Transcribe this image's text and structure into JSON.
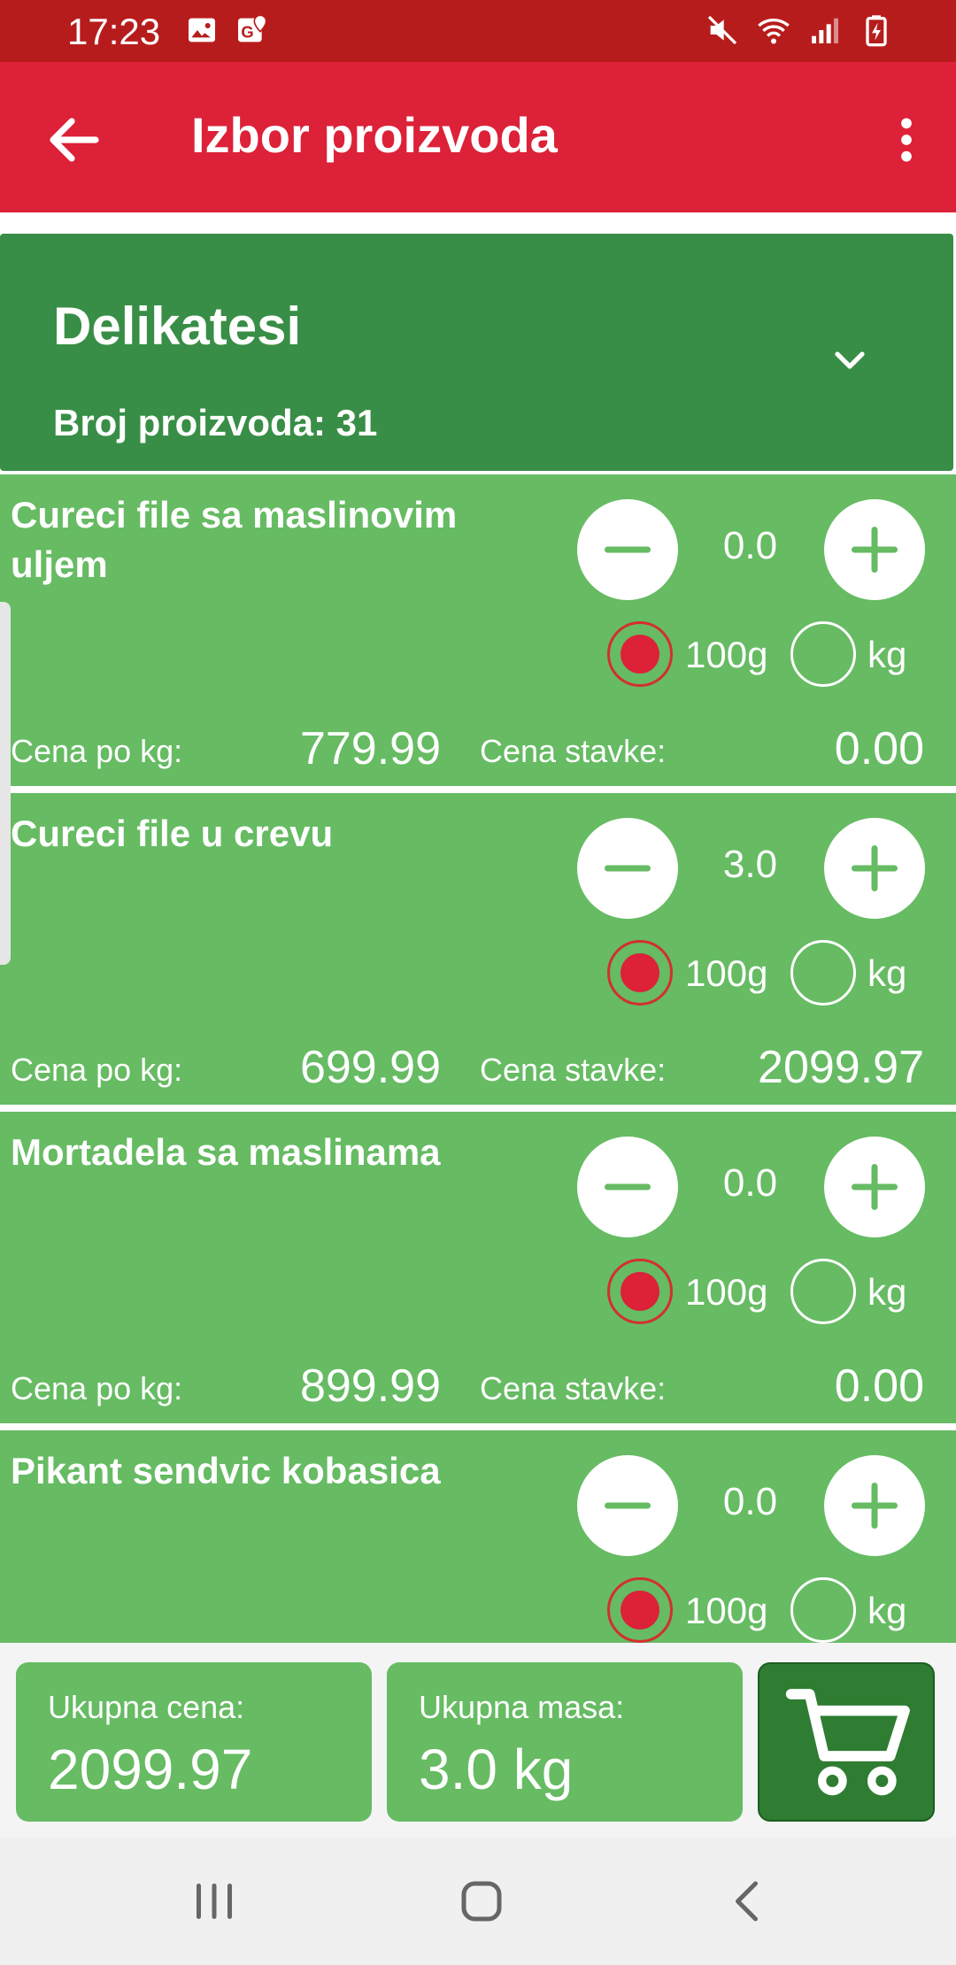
{
  "status_bar": {
    "time": "17:23"
  },
  "app_bar": {
    "title": "Izbor proizvoda"
  },
  "category": {
    "name": "Delikatesi",
    "count_label": "Broj proizvoda: 31"
  },
  "unit_options": {
    "g100": "100g",
    "kg": "kg"
  },
  "labels": {
    "price_per_kg": "Cena po kg:",
    "item_price": "Cena stavke:"
  },
  "products": [
    {
      "name": "Cureci file sa maslinovim uljem",
      "qty": "0.0",
      "price_per_kg": "779.99",
      "item_price": "0.00",
      "selected_unit": "100g"
    },
    {
      "name": "Cureci file u crevu",
      "qty": "3.0",
      "price_per_kg": "699.99",
      "item_price": "2099.97",
      "selected_unit": "100g"
    },
    {
      "name": "Mortadela sa maslinama",
      "qty": "0.0",
      "price_per_kg": "899.99",
      "item_price": "0.00",
      "selected_unit": "100g"
    },
    {
      "name": "Pikant sendvic kobasica",
      "qty": "0.0",
      "selected_unit": "100g"
    }
  ],
  "summary": {
    "total_price_label": "Ukupna cena:",
    "total_price": "2099.97",
    "total_mass_label": "Ukupna masa:",
    "total_mass": "3.0 kg"
  },
  "colors": {
    "status_bar": "#b71c1c",
    "app_bar": "#dc2138",
    "category": "#388e46",
    "product": "#66bb63",
    "cart": "#2e7d32",
    "radio_selected": "#dc2138"
  }
}
